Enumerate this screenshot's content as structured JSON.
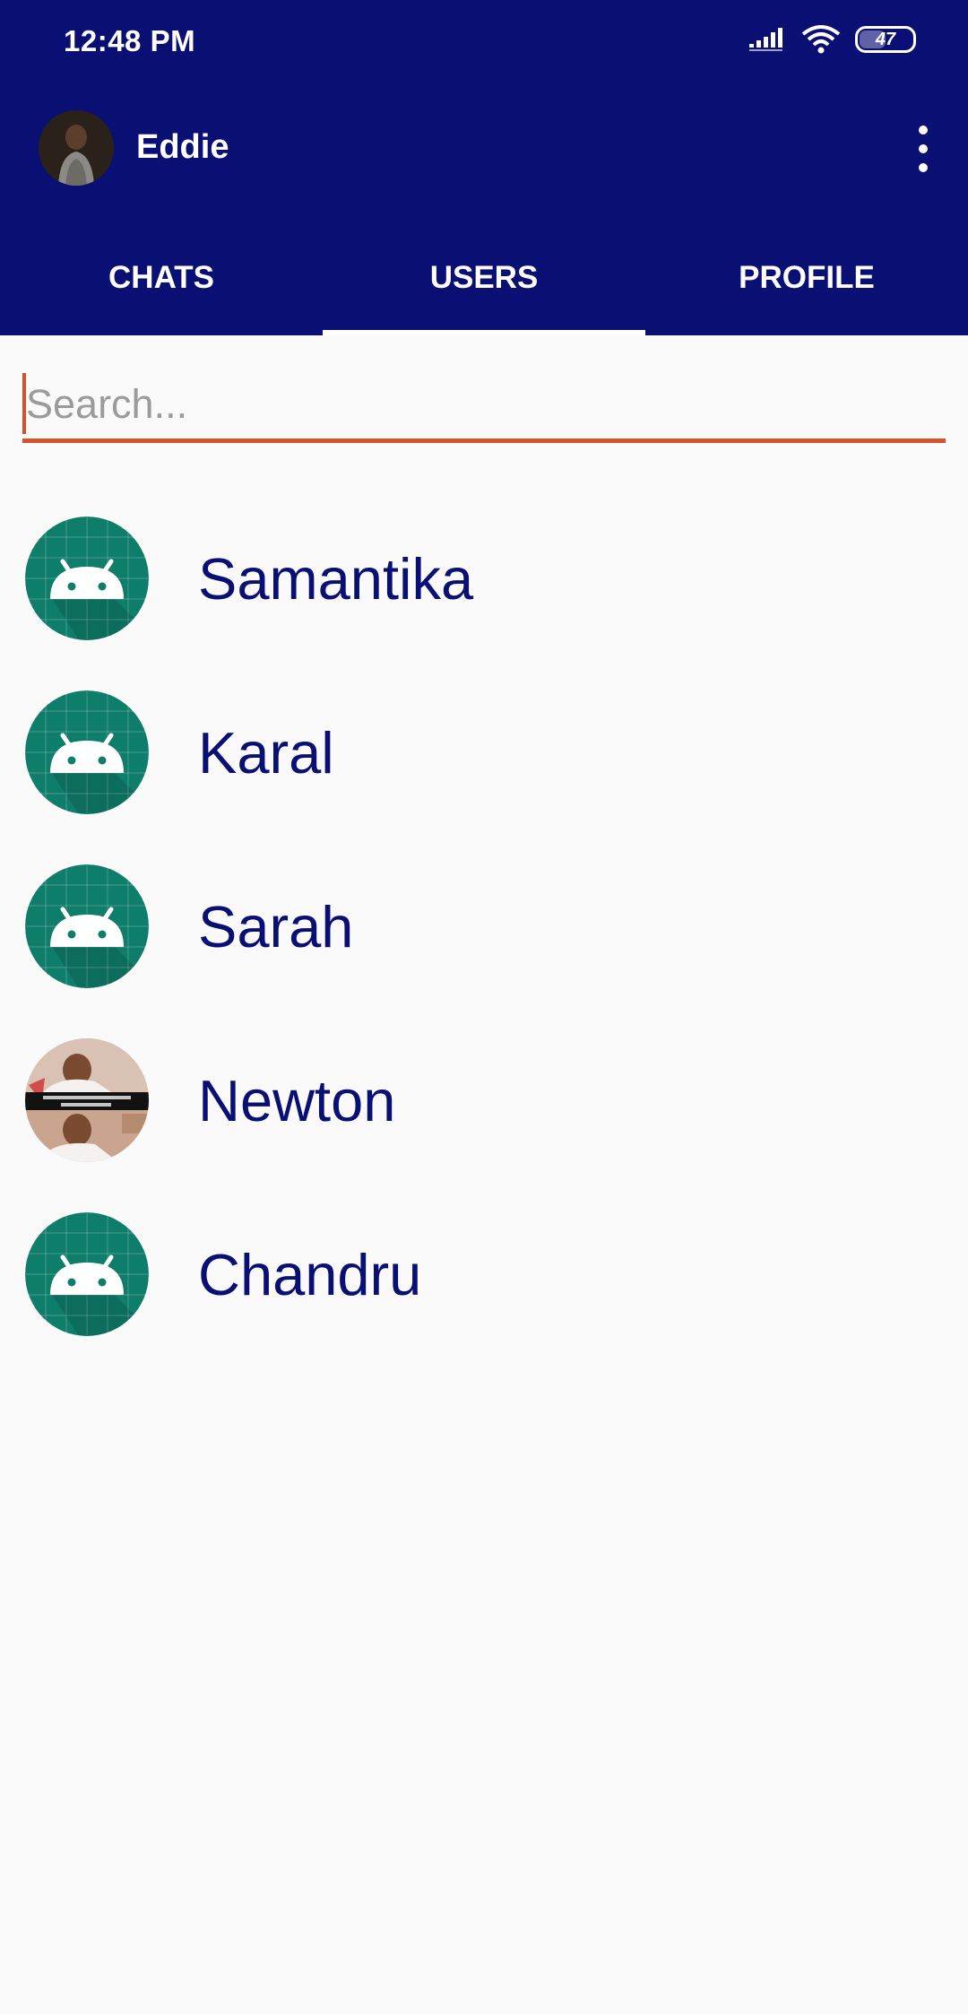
{
  "status_bar": {
    "time": "12:48 PM",
    "battery_level": "47",
    "battery_fraction": 0.47,
    "icons": [
      "signal-icon",
      "wifi-icon",
      "battery-icon"
    ]
  },
  "toolbar": {
    "profile_name": "Eddie",
    "menu_icon": "more-vert-icon"
  },
  "tabs": [
    {
      "label": "CHATS",
      "selected": false
    },
    {
      "label": "USERS",
      "selected": true
    },
    {
      "label": "PROFILE",
      "selected": false
    }
  ],
  "search": {
    "placeholder": "Search...",
    "value": ""
  },
  "users": [
    {
      "name": "Samantika",
      "avatar": "android-icon"
    },
    {
      "name": "Karal",
      "avatar": "android-icon"
    },
    {
      "name": "Sarah",
      "avatar": "android-icon"
    },
    {
      "name": "Newton",
      "avatar": "photo"
    },
    {
      "name": "Chandru",
      "avatar": "android-icon"
    }
  ],
  "colors": {
    "primary": "#0a0f73",
    "accent": "#d4522c",
    "avatar_teal": "#0e7d6a",
    "background": "#fafafa"
  }
}
